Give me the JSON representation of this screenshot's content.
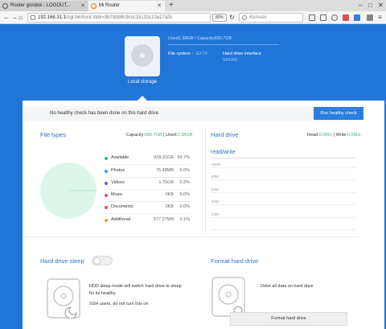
{
  "browser": {
    "tabs": [
      {
        "label": "Router gondok - LOGOUT..."
      },
      {
        "label": "Mi Router"
      }
    ],
    "url_host": "192.168.31.1",
    "url_path": "/cgi-bin/luci/;stok=3b7ddb9c9ccc15132c13a17a3c",
    "zoom": "80%",
    "search_placeholder": "Keresés"
  },
  "storage": {
    "used_capacity": "Used2.38GB / Capacity930.7GB",
    "fs_label": "File system :",
    "fs_value": "EXT4",
    "interface_label": "Hard drive interface",
    "interface_value": "SATAIII",
    "local_storage": "Local storage"
  },
  "health": {
    "message": "No healthy check has been done on this hard drive",
    "button": "Run healthy check"
  },
  "file_types": {
    "title": "File types",
    "capacity_label": "Capacity:",
    "capacity_value": "930.7GB",
    "used_label": "Used:",
    "used_value": "2.38GB",
    "items": [
      {
        "name": "Available",
        "size": "928.31GB",
        "pct": "99.7%",
        "color": "#3bb77e"
      },
      {
        "name": "Photos",
        "size": "75.48MB",
        "pct": "0.0%",
        "color": "#2a9fd6"
      },
      {
        "name": "Videos",
        "size": "1.75GB",
        "pct": "0.2%",
        "color": "#5b5bd6"
      },
      {
        "name": "Music",
        "size": "0KB",
        "pct": "0.0%",
        "color": "#d64ba0"
      },
      {
        "name": "Documents",
        "size": "0KB",
        "pct": "0.0%",
        "color": "#e05252"
      },
      {
        "name": "Additional",
        "size": "577.27MB",
        "pct": "0.1%",
        "color": "#f0a030"
      }
    ]
  },
  "hard_drive": {
    "title": "Hard drive",
    "read_label": "Read:",
    "read_value": "0.0M/s",
    "write_label": "Write:",
    "write_value": "0.0M/s",
    "rw_title": "read/write",
    "grid_labels": [
      "100M",
      "80M",
      "60M",
      "40M",
      "20M"
    ]
  },
  "sleep": {
    "title": "Hard drive sleep",
    "line1": "HDD sleep mode will switch hard drive to sleep",
    "line2": "for its healthy",
    "line3": "SSH users, do not turn this on"
  },
  "format": {
    "title": "Format hard drive",
    "text": "Delet all data on hard drive",
    "button": "Format hard drive"
  },
  "colors": {
    "accent": "#2175d9",
    "green": "#3bb77e"
  }
}
